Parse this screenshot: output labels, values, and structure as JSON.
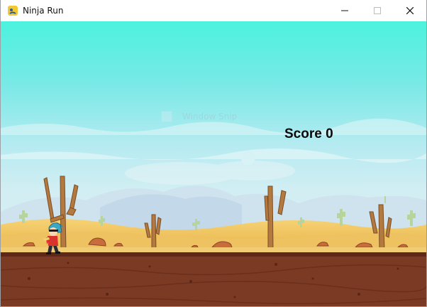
{
  "window": {
    "title": "Ninja Run",
    "icon": "pygame-snake-icon",
    "controls": [
      "minimize-icon",
      "maximize-icon",
      "close-icon"
    ]
  },
  "overlay": {
    "faint_label": "Window Snip"
  },
  "hud": {
    "score_label": "Score",
    "score_value": "0"
  },
  "colors": {
    "sky_top": "#4ef1de",
    "sky_bottom": "#bfeff0",
    "sand": "#f0c65a",
    "ground": "#7c3a22",
    "ground_edge": "#5a2414",
    "cactus": "#b47a46",
    "small_cactus": "#b9d39c"
  }
}
